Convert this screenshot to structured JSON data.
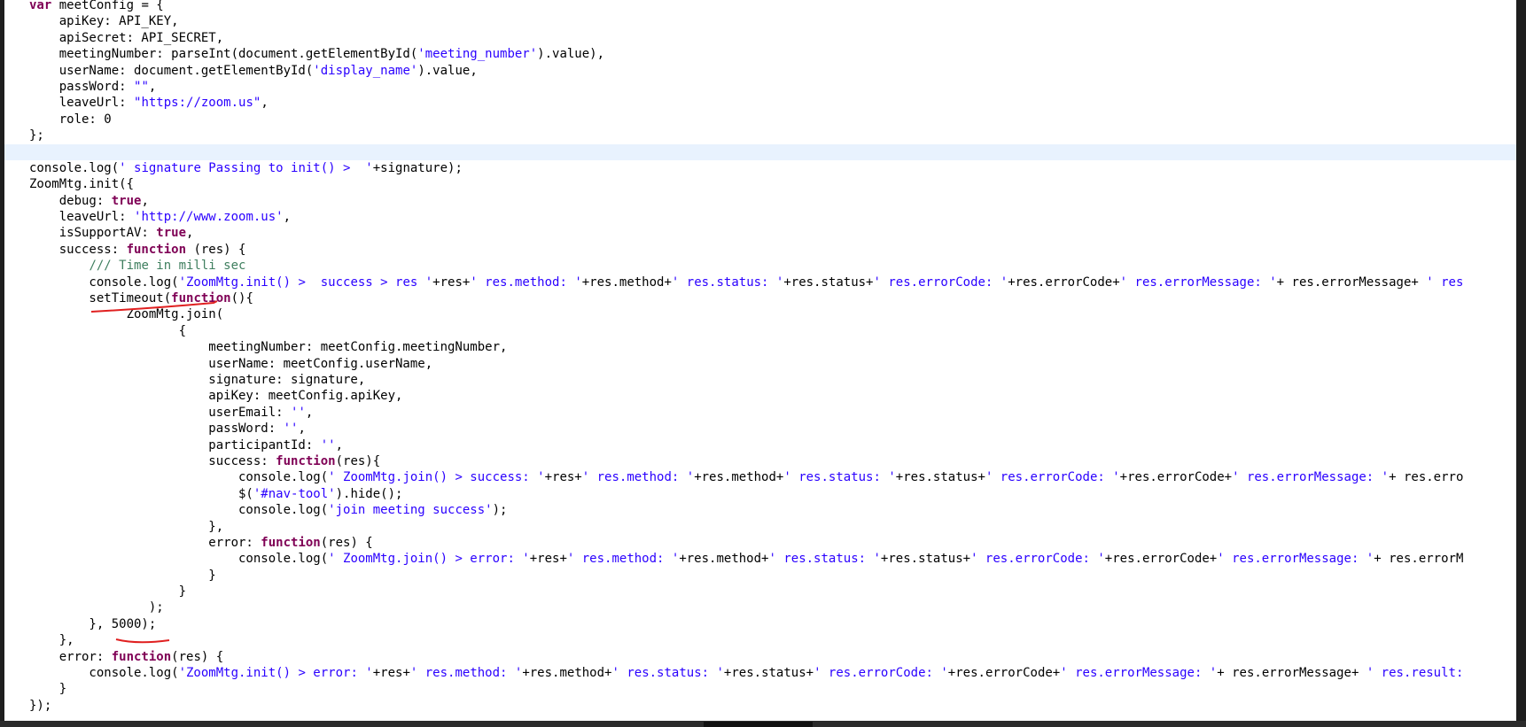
{
  "editor": {
    "lines": [
      {
        "tokens": [
          {
            "t": "kw",
            "v": "var"
          },
          {
            "t": "p",
            "v": " meetConfig = {"
          }
        ]
      },
      {
        "tokens": [
          {
            "t": "p",
            "v": "    apiKey: API_KEY,"
          }
        ]
      },
      {
        "tokens": [
          {
            "t": "p",
            "v": "    apiSecret: API_SECRET,"
          }
        ]
      },
      {
        "tokens": [
          {
            "t": "p",
            "v": "    meetingNumber: parseInt(document.getElementById("
          },
          {
            "t": "s",
            "v": "'meeting_number'"
          },
          {
            "t": "p",
            "v": ").value),"
          }
        ]
      },
      {
        "tokens": [
          {
            "t": "p",
            "v": "    userName: document.getElementById("
          },
          {
            "t": "s",
            "v": "'display_name'"
          },
          {
            "t": "p",
            "v": ").value,"
          }
        ]
      },
      {
        "tokens": [
          {
            "t": "p",
            "v": "    passWord: "
          },
          {
            "t": "s",
            "v": "\"\""
          },
          {
            "t": "p",
            "v": ","
          }
        ]
      },
      {
        "tokens": [
          {
            "t": "p",
            "v": "    leaveUrl: "
          },
          {
            "t": "s",
            "v": "\"https://zoom.us\""
          },
          {
            "t": "p",
            "v": ","
          }
        ]
      },
      {
        "tokens": [
          {
            "t": "p",
            "v": "    role: 0"
          }
        ]
      },
      {
        "tokens": [
          {
            "t": "p",
            "v": "};"
          }
        ]
      },
      {
        "tokens": [
          {
            "t": "p",
            "v": ""
          }
        ],
        "current": true
      },
      {
        "tokens": [
          {
            "t": "p",
            "v": "console.log("
          },
          {
            "t": "s",
            "v": "' signature Passing to init() >  '"
          },
          {
            "t": "p",
            "v": "+signature);"
          }
        ]
      },
      {
        "tokens": [
          {
            "t": "p",
            "v": "ZoomMtg.init({"
          }
        ]
      },
      {
        "tokens": [
          {
            "t": "p",
            "v": "    debug: "
          },
          {
            "t": "kw",
            "v": "true"
          },
          {
            "t": "p",
            "v": ","
          }
        ]
      },
      {
        "tokens": [
          {
            "t": "p",
            "v": "    leaveUrl: "
          },
          {
            "t": "s",
            "v": "'http://www.zoom.us'"
          },
          {
            "t": "p",
            "v": ","
          }
        ]
      },
      {
        "tokens": [
          {
            "t": "p",
            "v": "    isSupportAV: "
          },
          {
            "t": "kw",
            "v": "true"
          },
          {
            "t": "p",
            "v": ","
          }
        ]
      },
      {
        "tokens": [
          {
            "t": "p",
            "v": "    success: "
          },
          {
            "t": "kw",
            "v": "function"
          },
          {
            "t": "p",
            "v": " (res) {"
          }
        ]
      },
      {
        "tokens": [
          {
            "t": "p",
            "v": "        "
          },
          {
            "t": "c",
            "v": "/// Time in milli sec"
          }
        ]
      },
      {
        "tokens": [
          {
            "t": "p",
            "v": "        console.log("
          },
          {
            "t": "s",
            "v": "'ZoomMtg.init() >  success > res '"
          },
          {
            "t": "p",
            "v": "+res+"
          },
          {
            "t": "s",
            "v": "' res.method: '"
          },
          {
            "t": "p",
            "v": "+res.method+"
          },
          {
            "t": "s",
            "v": "' res.status: '"
          },
          {
            "t": "p",
            "v": "+res.status+"
          },
          {
            "t": "s",
            "v": "' res.errorCode: '"
          },
          {
            "t": "p",
            "v": "+res.errorCode+"
          },
          {
            "t": "s",
            "v": "' res.errorMessage: '"
          },
          {
            "t": "p",
            "v": "+ res.errorMessage+ "
          },
          {
            "t": "s",
            "v": "' res"
          }
        ]
      },
      {
        "tokens": [
          {
            "t": "p",
            "v": "        setTimeout("
          },
          {
            "t": "kw",
            "v": "function"
          },
          {
            "t": "p",
            "v": "(){"
          }
        ]
      },
      {
        "tokens": [
          {
            "t": "p",
            "v": "             ZoomMtg.join("
          }
        ]
      },
      {
        "tokens": [
          {
            "t": "p",
            "v": "                    {"
          }
        ]
      },
      {
        "tokens": [
          {
            "t": "p",
            "v": "                        meetingNumber: meetConfig.meetingNumber,"
          }
        ]
      },
      {
        "tokens": [
          {
            "t": "p",
            "v": "                        userName: meetConfig.userName,"
          }
        ]
      },
      {
        "tokens": [
          {
            "t": "p",
            "v": "                        signature: signature,"
          }
        ]
      },
      {
        "tokens": [
          {
            "t": "p",
            "v": "                        apiKey: meetConfig.apiKey,"
          }
        ]
      },
      {
        "tokens": [
          {
            "t": "p",
            "v": "                        userEmail: "
          },
          {
            "t": "s",
            "v": "''"
          },
          {
            "t": "p",
            "v": ","
          }
        ]
      },
      {
        "tokens": [
          {
            "t": "p",
            "v": "                        passWord: "
          },
          {
            "t": "s",
            "v": "''"
          },
          {
            "t": "p",
            "v": ","
          }
        ]
      },
      {
        "tokens": [
          {
            "t": "p",
            "v": "                        participantId: "
          },
          {
            "t": "s",
            "v": "''"
          },
          {
            "t": "p",
            "v": ","
          }
        ]
      },
      {
        "tokens": [
          {
            "t": "p",
            "v": "                        success: "
          },
          {
            "t": "kw",
            "v": "function"
          },
          {
            "t": "p",
            "v": "(res){"
          }
        ]
      },
      {
        "tokens": [
          {
            "t": "p",
            "v": "                            console.log("
          },
          {
            "t": "s",
            "v": "' ZoomMtg.join() > success: '"
          },
          {
            "t": "p",
            "v": "+res+"
          },
          {
            "t": "s",
            "v": "' res.method: '"
          },
          {
            "t": "p",
            "v": "+res.method+"
          },
          {
            "t": "s",
            "v": "' res.status: '"
          },
          {
            "t": "p",
            "v": "+res.status+"
          },
          {
            "t": "s",
            "v": "' res.errorCode: '"
          },
          {
            "t": "p",
            "v": "+res.errorCode+"
          },
          {
            "t": "s",
            "v": "' res.errorMessage: '"
          },
          {
            "t": "p",
            "v": "+ res.erro"
          }
        ]
      },
      {
        "tokens": [
          {
            "t": "p",
            "v": "                            $("
          },
          {
            "t": "s",
            "v": "'#nav-tool'"
          },
          {
            "t": "p",
            "v": ").hide();"
          }
        ]
      },
      {
        "tokens": [
          {
            "t": "p",
            "v": "                            console.log("
          },
          {
            "t": "s",
            "v": "'join meeting success'"
          },
          {
            "t": "p",
            "v": ");"
          }
        ]
      },
      {
        "tokens": [
          {
            "t": "p",
            "v": "                        },"
          }
        ]
      },
      {
        "tokens": [
          {
            "t": "p",
            "v": "                        error: "
          },
          {
            "t": "kw",
            "v": "function"
          },
          {
            "t": "p",
            "v": "(res) {"
          }
        ]
      },
      {
        "tokens": [
          {
            "t": "p",
            "v": "                            console.log("
          },
          {
            "t": "s",
            "v": "' ZoomMtg.join() > error: '"
          },
          {
            "t": "p",
            "v": "+res+"
          },
          {
            "t": "s",
            "v": "' res.method: '"
          },
          {
            "t": "p",
            "v": "+res.method+"
          },
          {
            "t": "s",
            "v": "' res.status: '"
          },
          {
            "t": "p",
            "v": "+res.status+"
          },
          {
            "t": "s",
            "v": "' res.errorCode: '"
          },
          {
            "t": "p",
            "v": "+res.errorCode+"
          },
          {
            "t": "s",
            "v": "' res.errorMessage: '"
          },
          {
            "t": "p",
            "v": "+ res.errorM"
          }
        ]
      },
      {
        "tokens": [
          {
            "t": "p",
            "v": "                        }"
          }
        ]
      },
      {
        "tokens": [
          {
            "t": "p",
            "v": "                    }"
          }
        ]
      },
      {
        "tokens": [
          {
            "t": "p",
            "v": "                );"
          }
        ]
      },
      {
        "tokens": [
          {
            "t": "p",
            "v": "        }, 5000);"
          }
        ]
      },
      {
        "tokens": [
          {
            "t": "p",
            "v": "    },"
          }
        ]
      },
      {
        "tokens": [
          {
            "t": "p",
            "v": "    error: "
          },
          {
            "t": "kw",
            "v": "function"
          },
          {
            "t": "p",
            "v": "(res) {"
          }
        ]
      },
      {
        "tokens": [
          {
            "t": "p",
            "v": "        console.log("
          },
          {
            "t": "s",
            "v": "'ZoomMtg.init() > error: '"
          },
          {
            "t": "p",
            "v": "+res+"
          },
          {
            "t": "s",
            "v": "' res.method: '"
          },
          {
            "t": "p",
            "v": "+res.method+"
          },
          {
            "t": "s",
            "v": "' res.status: '"
          },
          {
            "t": "p",
            "v": "+res.status+"
          },
          {
            "t": "s",
            "v": "' res.errorCode: '"
          },
          {
            "t": "p",
            "v": "+res.errorCode+"
          },
          {
            "t": "s",
            "v": "' res.errorMessage: '"
          },
          {
            "t": "p",
            "v": "+ res.errorMessage+ "
          },
          {
            "t": "s",
            "v": "' res.result:"
          }
        ]
      },
      {
        "tokens": [
          {
            "t": "p",
            "v": "    }"
          }
        ]
      },
      {
        "tokens": [
          {
            "t": "p",
            "v": "});"
          }
        ]
      }
    ]
  },
  "annotations": {
    "color": "#e02020"
  },
  "colors": {
    "keyword": "#7f0055",
    "string": "#2a00ff",
    "comment": "#3f7f5f",
    "current_line": "#e8f2fe",
    "background": "#ffffff"
  }
}
